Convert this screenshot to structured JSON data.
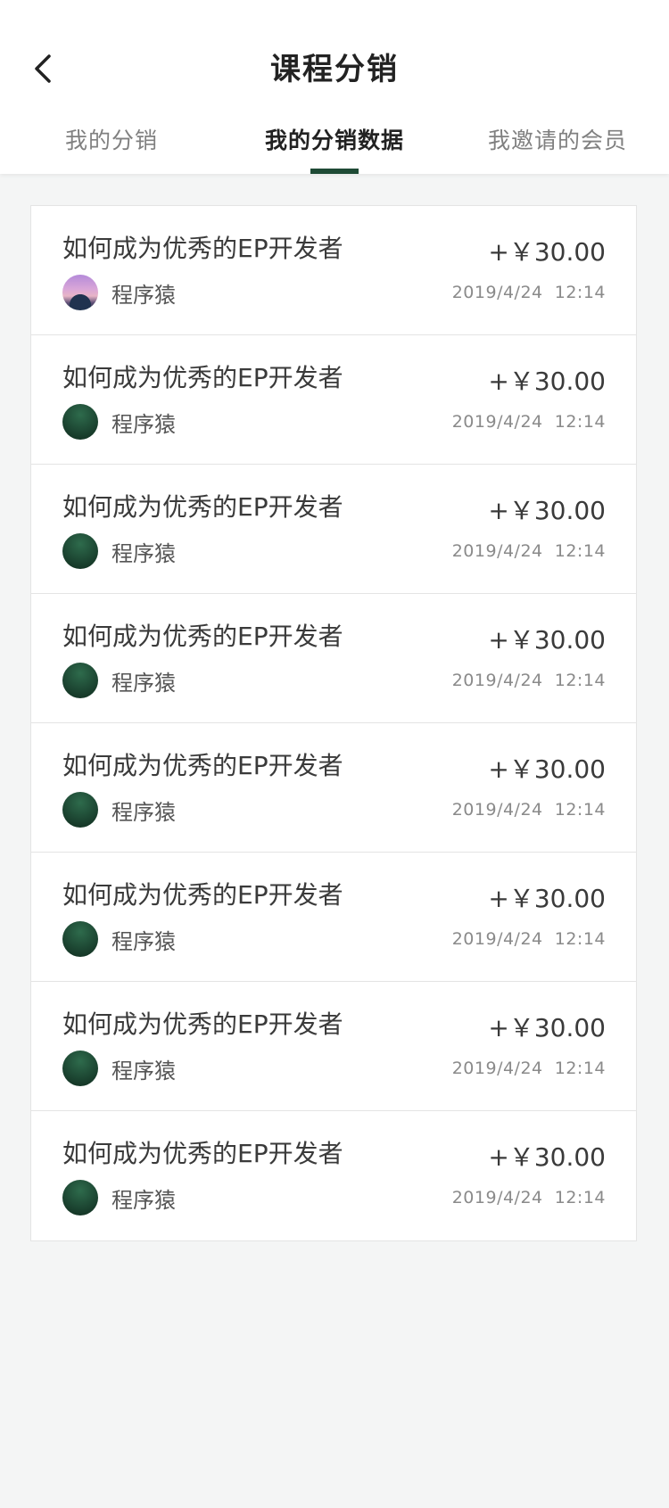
{
  "header": {
    "title": "课程分销",
    "back_icon": "chevron-left-icon"
  },
  "tabs": [
    {
      "label": "我的分销",
      "active": false
    },
    {
      "label": "我的分销数据",
      "active": true
    },
    {
      "label": "我邀请的会员",
      "active": false
    }
  ],
  "colors": {
    "accent": "#1e4a35",
    "background": "#f4f5f5"
  },
  "records": [
    {
      "title": "如何成为优秀的EP开发者",
      "amount": "+￥30.00",
      "user": "程序猿",
      "date": "2019/4/24",
      "time": "12:14"
    },
    {
      "title": "如何成为优秀的EP开发者",
      "amount": "+￥30.00",
      "user": "程序猿",
      "date": "2019/4/24",
      "time": "12:14"
    },
    {
      "title": "如何成为优秀的EP开发者",
      "amount": "+￥30.00",
      "user": "程序猿",
      "date": "2019/4/24",
      "time": "12:14"
    },
    {
      "title": "如何成为优秀的EP开发者",
      "amount": "+￥30.00",
      "user": "程序猿",
      "date": "2019/4/24",
      "time": "12:14"
    },
    {
      "title": "如何成为优秀的EP开发者",
      "amount": "+￥30.00",
      "user": "程序猿",
      "date": "2019/4/24",
      "time": "12:14"
    },
    {
      "title": "如何成为优秀的EP开发者",
      "amount": "+￥30.00",
      "user": "程序猿",
      "date": "2019/4/24",
      "time": "12:14"
    },
    {
      "title": "如何成为优秀的EP开发者",
      "amount": "+￥30.00",
      "user": "程序猿",
      "date": "2019/4/24",
      "time": "12:14"
    },
    {
      "title": "如何成为优秀的EP开发者",
      "amount": "+￥30.00",
      "user": "程序猿",
      "date": "2019/4/24",
      "time": "12:14"
    }
  ]
}
